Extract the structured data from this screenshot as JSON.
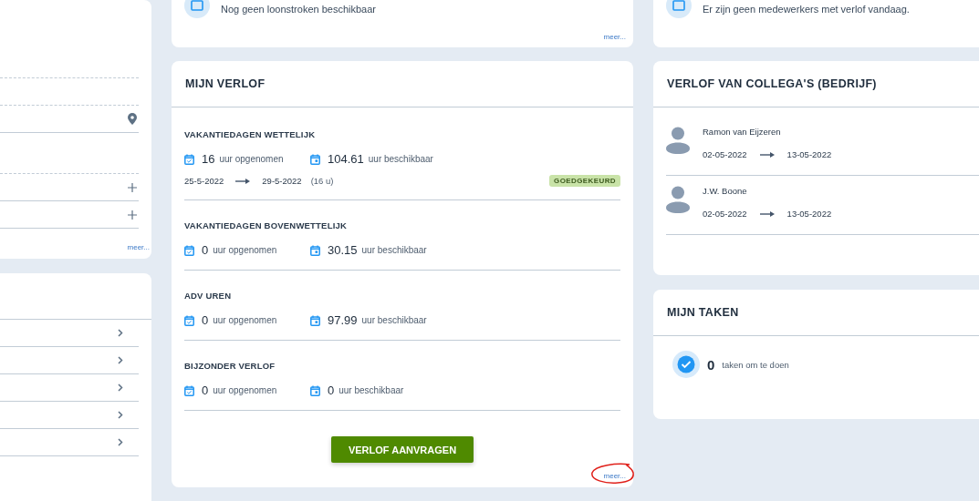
{
  "top_cards": [
    {
      "message": "Nog geen loonstroken beschikbaar",
      "link": "meer..."
    },
    {
      "message": "Er zijn geen medewerkers met verlof vandaag."
    }
  ],
  "left_card": {
    "rows": [
      {
        "kind": "blank"
      },
      {
        "kind": "location"
      },
      {
        "kind": "blank"
      },
      {
        "kind": "add"
      },
      {
        "kind": "add"
      }
    ],
    "link": "meer..."
  },
  "left_list": {
    "rows": [
      {
        "kind": "chevron"
      },
      {
        "kind": "chevron"
      },
      {
        "kind": "chevron"
      },
      {
        "kind": "chevron"
      },
      {
        "kind": "chevron"
      }
    ]
  },
  "my_leave": {
    "title": "MIJN VERLOF",
    "sections": [
      {
        "title": "VAKANTIEDAGEN WETTELIJK",
        "taken": "16",
        "taken_label": "uur opgenomen",
        "available": "104.61",
        "available_label": "uur beschikbaar",
        "requests": [
          {
            "start": "25-5-2022",
            "end": "29-5-2022",
            "hours": "(16 u)",
            "status": "GOEDGEKEURD"
          }
        ]
      },
      {
        "title": "VAKANTIEDAGEN BOVENWETTELIJK",
        "taken": "0",
        "taken_label": "uur opgenomen",
        "available": "30.15",
        "available_label": "uur beschikbaar"
      },
      {
        "title": "ADV UREN",
        "taken": "0",
        "taken_label": "uur opgenomen",
        "available": "97.99",
        "available_label": "uur beschikbaar"
      },
      {
        "title": "BIJZONDER VERLOF",
        "taken": "0",
        "taken_label": "uur opgenomen",
        "available": "0",
        "available_label": "uur beschikbaar"
      }
    ],
    "button": "VERLOF AANVRAGEN",
    "link": "meer..."
  },
  "colleagues_leave": {
    "title": "VERLOF VAN COLLEGA'S (BEDRIJF)",
    "items": [
      {
        "name": "Ramon van Eijzeren",
        "start": "02-05-2022",
        "end": "13-05-2022"
      },
      {
        "name": "J.W. Boone",
        "start": "02-05-2022",
        "end": "13-05-2022"
      }
    ]
  },
  "my_tasks": {
    "title": "MIJN TAKEN",
    "count": "0",
    "label": "taken om te doen"
  }
}
